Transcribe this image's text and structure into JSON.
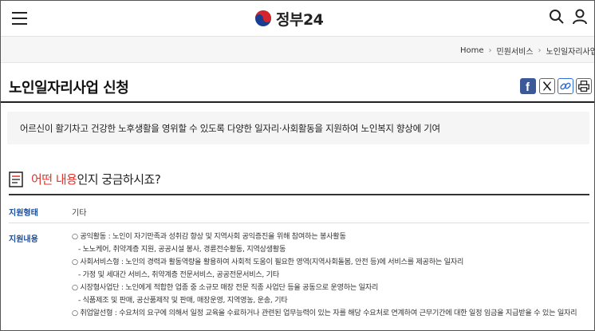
{
  "header": {
    "logo_text": "정부24",
    "menu_icon": "hamburger-menu-icon",
    "search_icon": "search-icon",
    "user_icon": "user-icon"
  },
  "breadcrumb": {
    "items": [
      "Home",
      "민원서비스",
      "노인일자리사업 신"
    ]
  },
  "page": {
    "title": "노인일자리사업 신청",
    "share": {
      "facebook": "f",
      "x": "X",
      "link": "link-icon",
      "print": "print-icon"
    }
  },
  "summary": {
    "text": "어르신이 활기차고 건강한 노후생활을 영위할 수 있도록 다양한 일자리·사회활동을 지원하여 노인복지 향상에 기여"
  },
  "question": {
    "prefix": "어떤 내용",
    "suffix": "인지 궁금하시죠?"
  },
  "details": {
    "support_type_label": "지원형태",
    "support_type_value": "기타",
    "support_content_label": "지원내용",
    "lines": [
      "○ 공익활동 : 노인이 자기만족과 성취감 향상 및 지역사회 공익증진을 위해 참여하는 봉사활동",
      "- 노노케어, 취약계층 지원, 공공시설 봉사, 경륜전수활동, 지역상생활동",
      "○ 사회서비스형 : 노인의 경력과 활동역량을 활용하여 사회적 도움이 필요한 영역(지역사회돌봄, 안전 등)에 서비스를 제공하는 일자리",
      "- 가정 및 세대간 서비스, 취약계층 전문서비스, 공공전문서비스, 기타",
      "○ 시장형사업단 : 노인에게 적합한 업종 중 소규모 매장 전문 직종 사업단 등을 공동으로 운영하는 일자리",
      "- 식품제조 및 판매, 공산품제작 및 판매, 매장운영, 지역영농, 운송, 기타",
      "○ 취업알선형 : 수요처의 요구에 의해서 일정 교육을 수료하거나 관련된 업무능력이 있는 자를 해당 수요처로 연계하여 근무기간에 대한 일정 임금을 지급받을 수 있는 일자리"
    ]
  }
}
